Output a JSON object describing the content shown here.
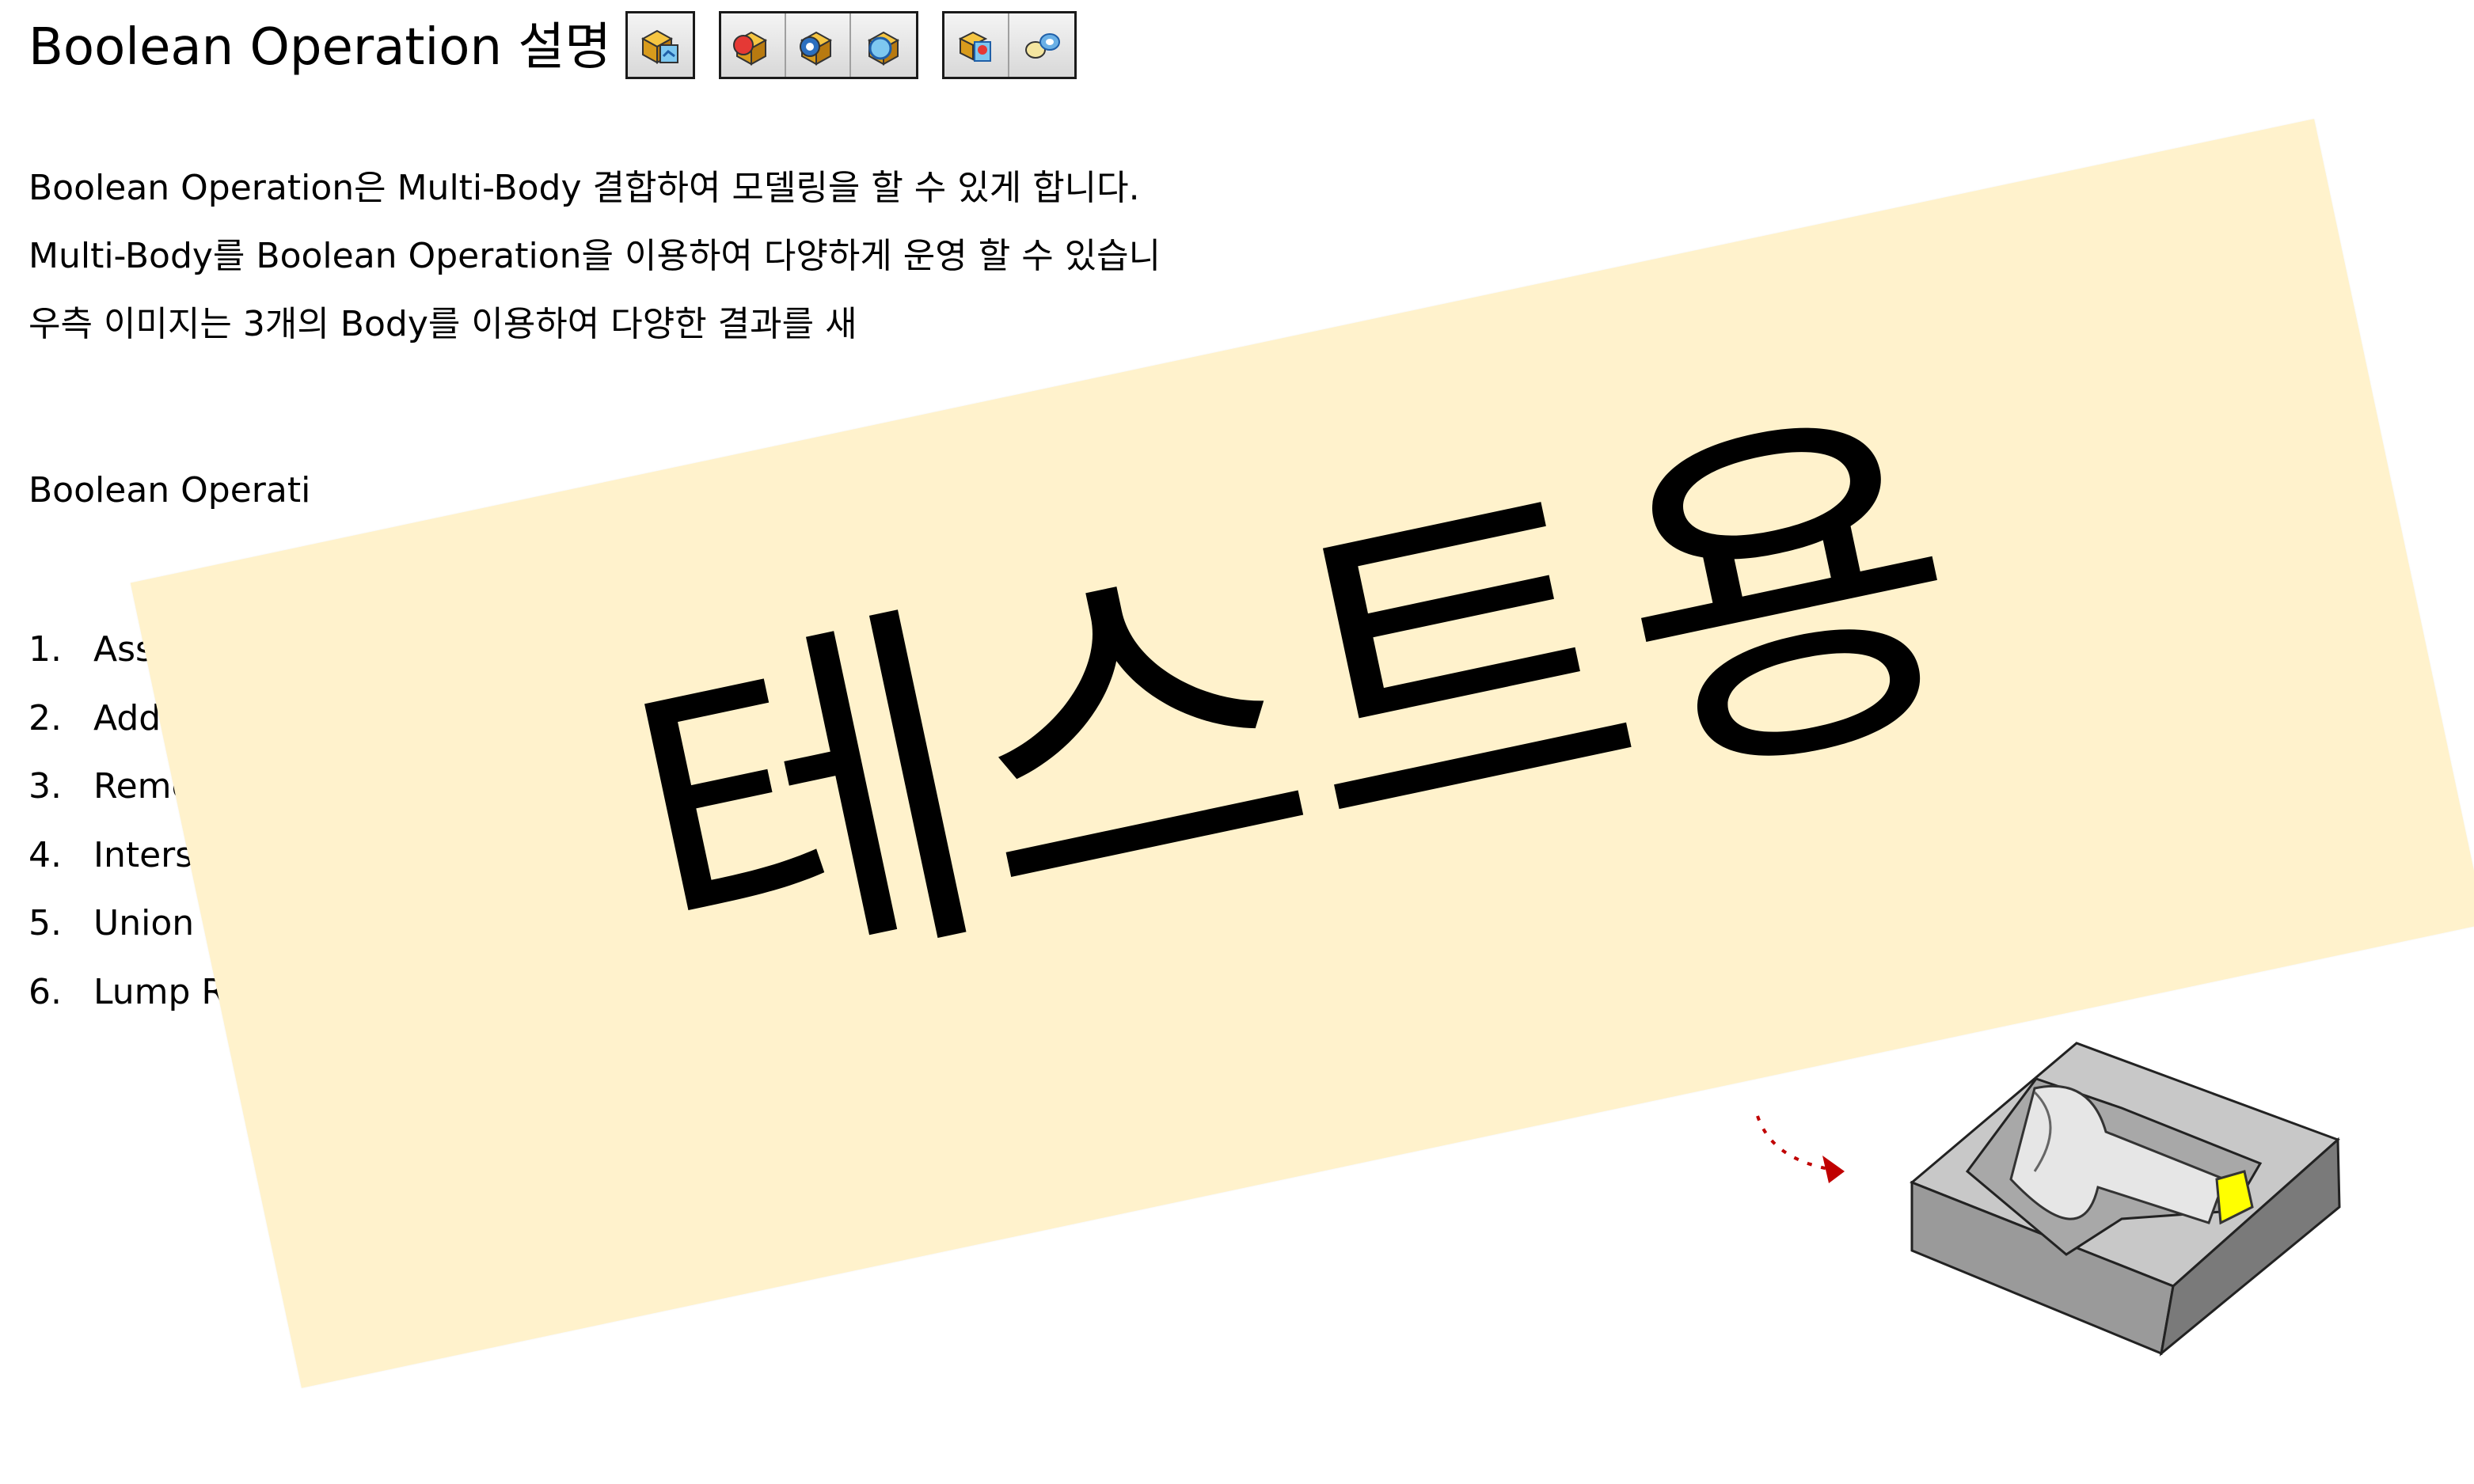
{
  "title": "Boolean Operation 설명",
  "toolbars": [
    {
      "buttons": [
        {
          "icon": "assemble-icon"
        }
      ]
    },
    {
      "buttons": [
        {
          "icon": "add-icon"
        },
        {
          "icon": "remove-icon"
        },
        {
          "icon": "intersect-icon"
        }
      ]
    },
    {
      "buttons": [
        {
          "icon": "union-trim-icon"
        },
        {
          "icon": "remove-lump-icon"
        }
      ]
    }
  ],
  "paragraphs": [
    "Boolean Operation은 Multi-Body 결합하여 모델링을 할 수 있게 합니다.",
    "Multi-Body를 Boolean Operation을 이용하여 다양하게 운영 할 수 있습니",
    "우측 이미지는 3개의 Body를 이용하여 다양한 결과를 새"
  ],
  "section_label": "Boolean Operati",
  "list_items": [
    {
      "num": "1.",
      "text": "Asse"
    },
    {
      "num": "2.",
      "text": "Add"
    },
    {
      "num": "3.",
      "text": "Remov"
    },
    {
      "num": "4.",
      "text": "Intersec"
    },
    {
      "num": "5.",
      "text": "Union T"
    },
    {
      "num": "6.",
      "text": "Lump Re"
    }
  ],
  "overlay": {
    "text": "테스트용",
    "background": "#fff2cc"
  },
  "colors": {
    "text": "#000000",
    "arrow": "#c00000",
    "part_face": "#c8c8c8",
    "part_side": "#8c8c8c",
    "highlight": "#ffff00"
  }
}
